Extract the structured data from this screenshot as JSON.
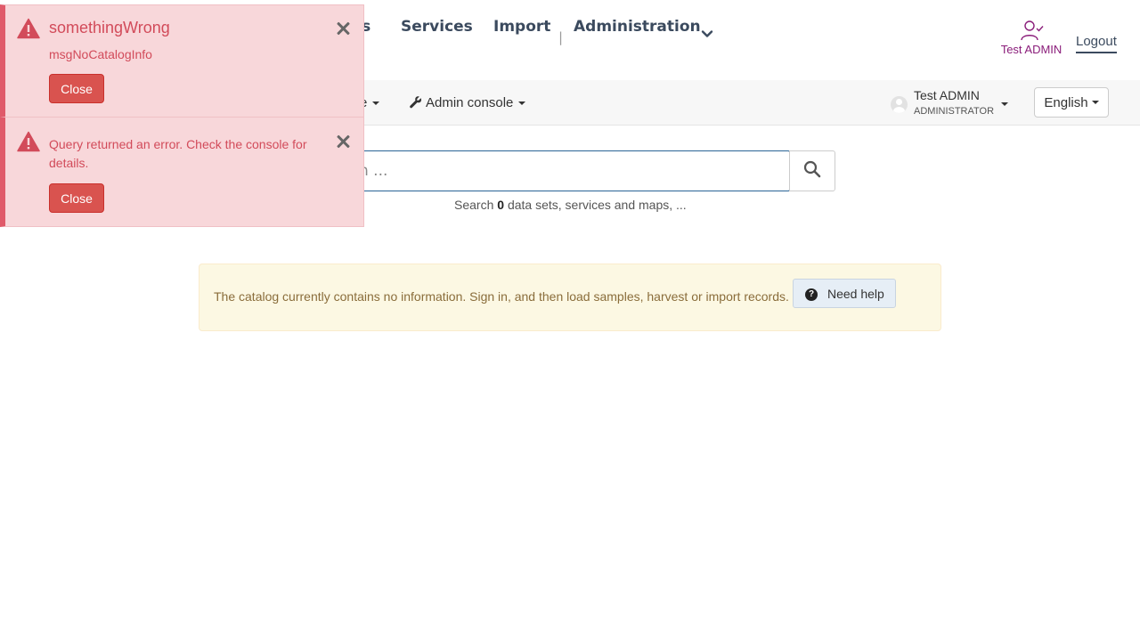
{
  "header": {
    "nav": [
      {
        "label": "ps"
      },
      {
        "label": "Services"
      },
      {
        "label": "Import"
      },
      {
        "label": "|"
      },
      {
        "label": "Administration"
      }
    ],
    "user_label": "Test ADMIN",
    "logout_label": "Logout",
    "user_color": "#8a1d7a"
  },
  "toolbar": {
    "truncated_menu_label": "e",
    "admin_console_label": "Admin console",
    "profile": {
      "name": "Test ADMIN",
      "role": "ADMINISTRATOR"
    },
    "language": "English"
  },
  "search": {
    "placeholder_visible": "h ...",
    "hint_prefix": "Search",
    "record_count": "0",
    "hint_suffix": "data sets, services and maps, ..."
  },
  "info_alert": {
    "message": "The catalog currently contains no information. Sign in, and then load samples, harvest or import records.",
    "help_label": "Need help",
    "help_icon": "question-circle-icon"
  },
  "toasts": [
    {
      "title": "somethingWrong",
      "message": "msgNoCatalogInfo",
      "close_label": "Close",
      "icon": "warning-triangle-icon"
    },
    {
      "title": "",
      "message": "Query returned an error. Check the console for details.",
      "close_label": "Close",
      "icon": "warning-triangle-icon"
    }
  ],
  "colors": {
    "error_bg": "#f8d7da",
    "error_text": "#d24b5a",
    "error_accent": "#e05a6a",
    "close_button": "#d9534f",
    "warning_bg": "#fcf8e3",
    "warning_text": "#8a6d3b",
    "search_border": "#2a6496"
  }
}
